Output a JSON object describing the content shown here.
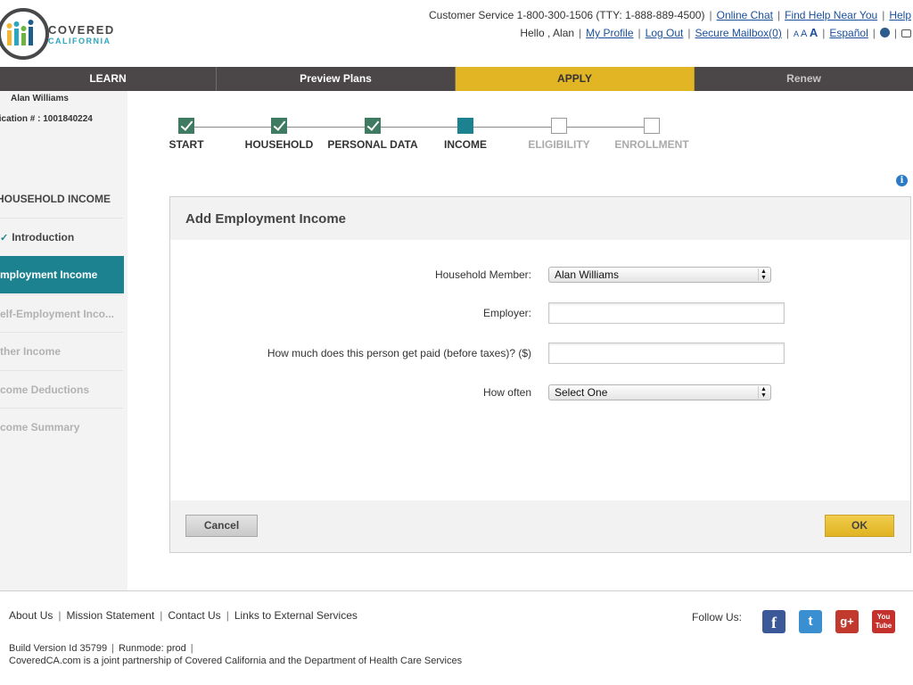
{
  "header": {
    "logo_text": "COVERED",
    "logo_subtext": "CALIFORNIA",
    "customer_service": "Customer Service 1-800-300-1506 (TTY: 1-888-889-4500)",
    "online_chat": "Online Chat",
    "find_help": "Find Help Near You",
    "help": "Help",
    "greeting": "Hello , Alan",
    "my_profile": "My Profile",
    "log_out": "Log Out",
    "secure_mailbox": "Secure Mailbox(0)",
    "font_small": "A",
    "font_medium": "A",
    "font_large": "A",
    "espanol": "Español"
  },
  "nav": {
    "learn": "LEARN",
    "preview": "Preview Plans",
    "apply": "APPLY",
    "renew": "Renew"
  },
  "sidebar": {
    "applicant_name": "Alan Williams",
    "application_number": "lication # : 1001840224",
    "heading": "HOUSEHOLD INCOME",
    "items": [
      {
        "label": "Introduction",
        "state": "done"
      },
      {
        "label": "mployment Income",
        "state": "active"
      },
      {
        "label": "elf-Employment Inco...",
        "state": "future"
      },
      {
        "label": "ther Income",
        "state": "future"
      },
      {
        "label": "come Deductions",
        "state": "future"
      },
      {
        "label": "come Summary",
        "state": "future"
      }
    ]
  },
  "steps": [
    {
      "label": "START",
      "state": "done"
    },
    {
      "label": "HOUSEHOLD",
      "state": "done"
    },
    {
      "label": "PERSONAL DATA",
      "state": "done"
    },
    {
      "label": "INCOME",
      "state": "current"
    },
    {
      "label": "ELIGIBILITY",
      "state": "future"
    },
    {
      "label": "ENROLLMENT",
      "state": "future"
    }
  ],
  "dialog": {
    "title": "Add Employment Income",
    "household_member_label": "Household Member:",
    "household_member_value": "Alan Williams",
    "employer_label": "Employer:",
    "employer_value": "",
    "pay_label": "How much does this person get paid (before taxes)? ($)",
    "pay_value": "",
    "how_often_label": "How often",
    "how_often_value": "Select One",
    "cancel": "Cancel",
    "ok": "OK"
  },
  "footer": {
    "about": "About Us",
    "mission": "Mission Statement",
    "contact": "Contact Us",
    "links": "Links to External Services",
    "follow": "Follow Us:",
    "build": "Build Version Id 35799",
    "runmode": "Runmode: prod",
    "partnership": "CoveredCA.com is a joint partnership of Covered California and the Department of Health Care Services",
    "social": {
      "facebook": "f",
      "twitter": "t",
      "googleplus": "g+",
      "youtube_top": "You",
      "youtube_bottom": "Tube"
    }
  },
  "colors": {
    "teal": "#1d8290",
    "gold": "#e1b524",
    "nav_dark": "#4b4749",
    "step_done": "#3f7b62"
  }
}
